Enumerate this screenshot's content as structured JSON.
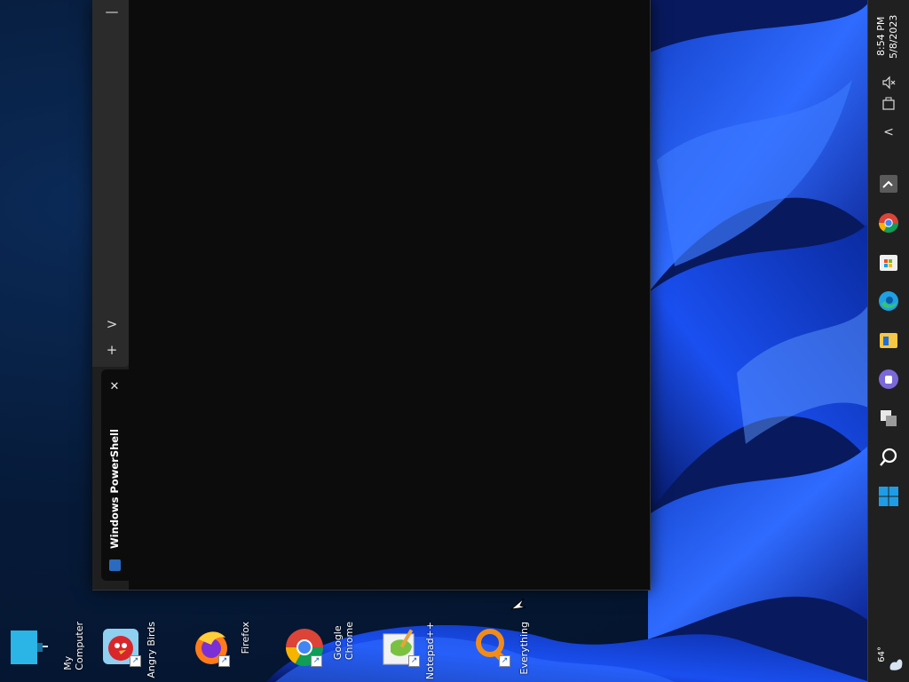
{
  "desktop": {
    "icons": [
      {
        "id": "my-computer",
        "label": "My\nComputer"
      },
      {
        "id": "angry-birds",
        "label": "Angry Birds"
      },
      {
        "id": "firefox",
        "label": "Firefox"
      },
      {
        "id": "google-chrome",
        "label": "Google\nChrome"
      },
      {
        "id": "notepadpp",
        "label": "Notepad++"
      },
      {
        "id": "everything",
        "label": "Everything"
      }
    ]
  },
  "terminal": {
    "tab_title": "Windows PowerShell",
    "new_tab_symbol": "+",
    "dropdown_symbol": ">",
    "minimize_symbol": "—",
    "close_symbol": "✕"
  },
  "taskbar": {
    "time": "8:54 PM",
    "date": "5/8/2023",
    "weather_temp": "64°",
    "overflow_symbol": "<",
    "colors": {
      "background": "#202020",
      "accent": "#0078d4"
    }
  }
}
